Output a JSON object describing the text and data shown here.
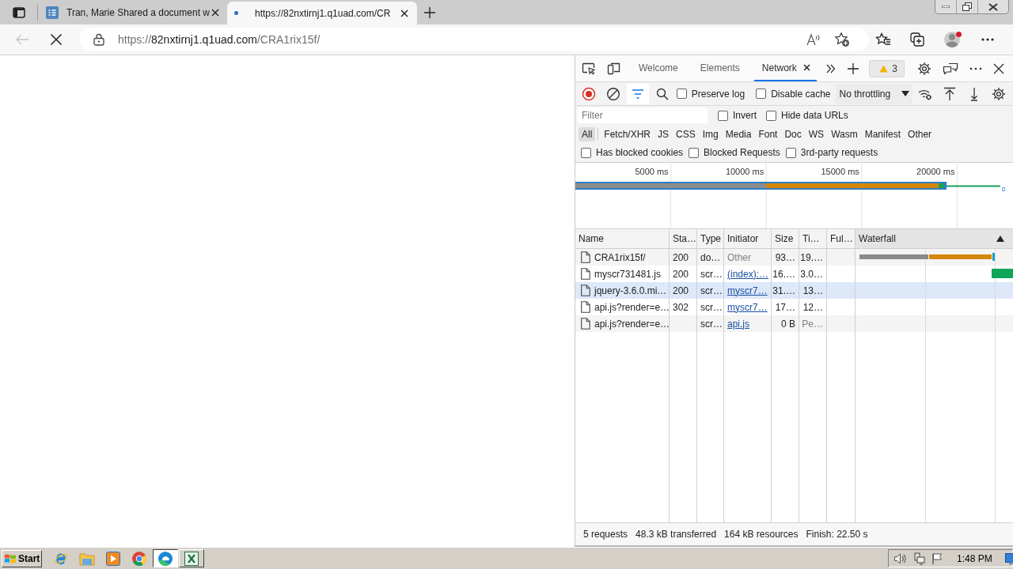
{
  "browser": {
    "tabs": [
      {
        "title": "Tran, Marie Shared a document w",
        "selected": false,
        "loading": false
      },
      {
        "title": "https://82nxtirnj1.q1uad.com/CR",
        "selected": true,
        "loading": true
      }
    ],
    "address_bar": {
      "back_enabled": false,
      "loading": true,
      "url_parts": [
        {
          "text": "https://",
          "kind": "dim"
        },
        {
          "text": "82nxtirnj1.q1uad.com",
          "kind": "host"
        },
        {
          "text": "/CRA1rix15f/",
          "kind": "dim"
        }
      ]
    },
    "profile": {
      "notification": true
    }
  },
  "devtools": {
    "tabs": [
      {
        "label": "Welcome",
        "selected": false
      },
      {
        "label": "Elements",
        "selected": false
      },
      {
        "label": "Network",
        "selected": true
      }
    ],
    "issues_badge": "3",
    "toolbar": {
      "recording": true,
      "filter_shown": true,
      "checkboxes": [
        {
          "label": "Preserve log",
          "checked": false
        },
        {
          "label": "Disable cache",
          "checked": false
        }
      ],
      "throttling": "No throttling"
    },
    "filter": {
      "placeholder": "Filter",
      "checkboxes": [
        {
          "label": "Invert",
          "checked": false
        },
        {
          "label": "Hide data URLs",
          "checked": false
        }
      ]
    },
    "type_filters": [
      {
        "label": "All",
        "selected": true
      },
      {
        "label": "Fetch/XHR",
        "selected": false
      },
      {
        "label": "JS",
        "selected": false
      },
      {
        "label": "CSS",
        "selected": false
      },
      {
        "label": "Img",
        "selected": false
      },
      {
        "label": "Media",
        "selected": false
      },
      {
        "label": "Font",
        "selected": false
      },
      {
        "label": "Doc",
        "selected": false
      },
      {
        "label": "WS",
        "selected": false
      },
      {
        "label": "Wasm",
        "selected": false
      },
      {
        "label": "Manifest",
        "selected": false
      },
      {
        "label": "Other",
        "selected": false
      }
    ],
    "blocked_filters": [
      {
        "label": "Has blocked cookies",
        "checked": false
      },
      {
        "label": "Blocked Requests",
        "checked": false
      },
      {
        "label": "3rd-party requests",
        "checked": false
      }
    ],
    "overview": {
      "tick_labels": [
        "5000 ms",
        "10000 ms",
        "15000 ms",
        "20000 ms"
      ]
    },
    "table": {
      "sort_ascending": true,
      "columns": [
        {
          "label": "Name",
          "sorted": false
        },
        {
          "label": "Sta…",
          "sorted": false
        },
        {
          "label": "Type",
          "sorted": false
        },
        {
          "label": "Initiator",
          "sorted": false
        },
        {
          "label": "Size",
          "sorted": false
        },
        {
          "label": "Ti…",
          "sorted": false
        },
        {
          "label": "Ful…",
          "sorted": false
        },
        {
          "label": "Waterfall",
          "sorted": true
        }
      ],
      "rows": [
        {
          "name": "CRA1rix15f/",
          "status": "200",
          "type": "do…",
          "initiator": "Other",
          "initiator_link": false,
          "size": "93…",
          "time": "19.…",
          "pending": false,
          "highlighted": false
        },
        {
          "name": "myscr731481.js",
          "status": "200",
          "type": "scr…",
          "initiator": "(index):…",
          "initiator_link": true,
          "size": "16.…",
          "time": "3.0…",
          "pending": false,
          "highlighted": false
        },
        {
          "name": "jquery-3.6.0.mi…",
          "status": "200",
          "type": "scr…",
          "initiator": "myscr7…",
          "initiator_link": true,
          "size": "31.…",
          "time": "13…",
          "pending": false,
          "highlighted": true
        },
        {
          "name": "api.js?render=e…",
          "status": "302",
          "type": "scr…",
          "initiator": "myscr7…",
          "initiator_link": true,
          "size": "17…",
          "time": "12…",
          "pending": false,
          "highlighted": false
        },
        {
          "name": "api.js?render=e…",
          "type": "scr…",
          "initiator": "api.js",
          "initiator_link": true,
          "size": "0 B",
          "time": "Pe…",
          "pending": true,
          "highlighted": false
        }
      ]
    },
    "summary": [
      "5 requests",
      "48.3 kB transferred",
      "164 kB resources",
      "Finish: 22.50 s"
    ]
  },
  "taskbar": {
    "start": "Start",
    "apps": [
      {
        "kind": "ie",
        "open": false,
        "active": false
      },
      {
        "kind": "folder",
        "open": false,
        "active": false
      },
      {
        "kind": "media",
        "open": false,
        "active": false
      },
      {
        "kind": "chrome",
        "open": false,
        "active": false
      },
      {
        "kind": "edge",
        "open": true,
        "active": true
      },
      {
        "kind": "excel",
        "open": true,
        "active": false
      }
    ],
    "clock": "1:48 PM"
  }
}
